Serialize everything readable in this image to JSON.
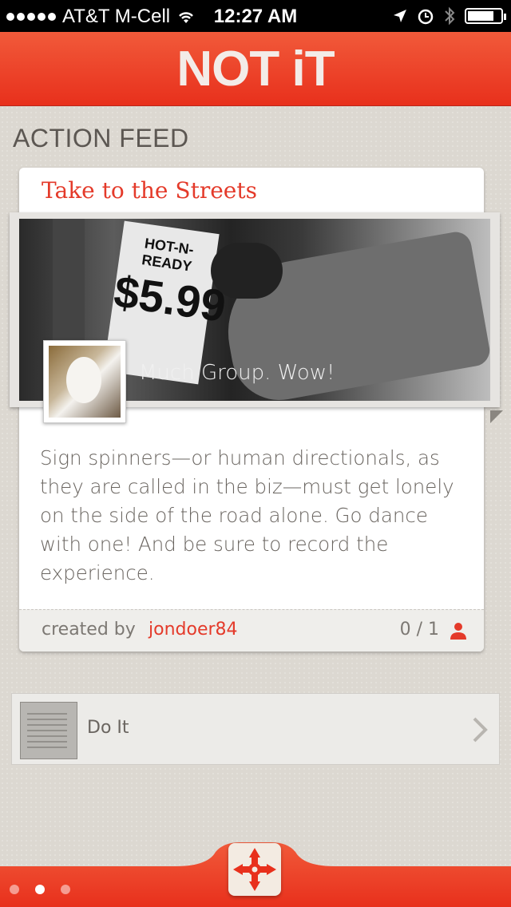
{
  "status_bar": {
    "carrier": "AT&T M-Cell",
    "time": "12:27 AM",
    "battery_level": 0.85
  },
  "header": {
    "logo": "NOT iT"
  },
  "feed": {
    "title": "ACTION FEED"
  },
  "card": {
    "title": "Take to the Streets",
    "photo_caption": "Much Group. Wow!",
    "photo_sign_price": "$5.99",
    "photo_sign_text": "HOT-N-READY",
    "description": "Sign spinners—or human directionals, as they are called in the biz—must get lonely on the side of the road alone. Go dance with one! And be sure to record the experience.",
    "created_by_label": "created by",
    "username": "jondoer84",
    "count": "0 / 1"
  },
  "do_it": {
    "label": "Do It"
  },
  "bottom_bar": {
    "pages": 3,
    "active_page": 2
  },
  "colors": {
    "brand_red": "#e8301c",
    "text_red": "#e43a2a"
  }
}
